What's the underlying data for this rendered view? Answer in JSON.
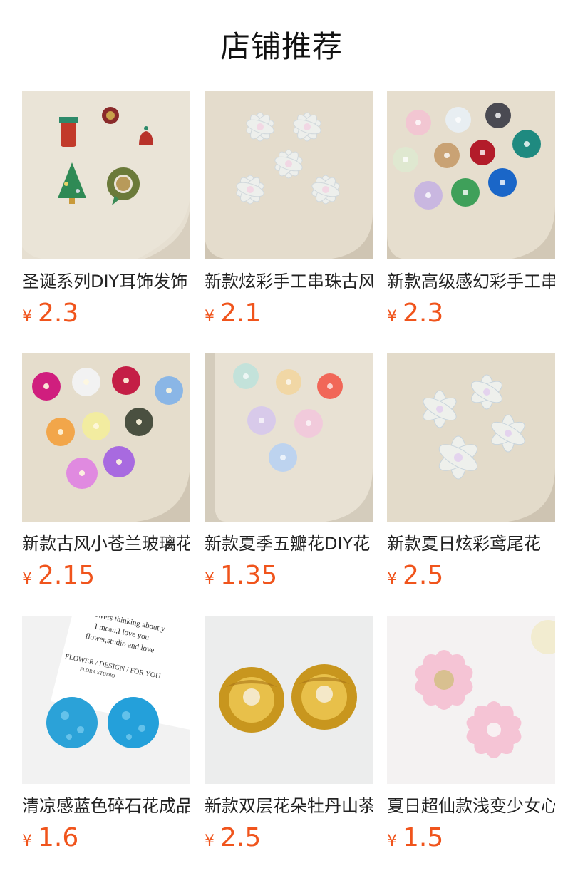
{
  "section": {
    "title": "店铺推荐"
  },
  "colors": {
    "price": "#f0541c",
    "text": "#222222"
  },
  "products": [
    {
      "name": "圣诞系列DIY耳饰发饰",
      "currency": "¥",
      "price": "2.3",
      "image_icon": "christmas-ornaments-image"
    },
    {
      "name": "新款炫彩手工串珠古风",
      "currency": "¥",
      "price": "2.1",
      "image_icon": "iridescent-flowers-image"
    },
    {
      "name": "新款高级感幻彩手工串",
      "currency": "¥",
      "price": "2.3",
      "image_icon": "colorful-sequin-flowers-image"
    },
    {
      "name": "新款古风小苍兰玻璃花",
      "currency": "¥",
      "price": "2.15",
      "image_icon": "freesia-glass-flowers-image"
    },
    {
      "name": "新款夏季五瓣花DIY花",
      "currency": "¥",
      "price": "1.35",
      "image_icon": "five-petal-flowers-image"
    },
    {
      "name": "新款夏日炫彩鸢尾花",
      "currency": "¥",
      "price": "2.5",
      "image_icon": "iris-flowers-image"
    },
    {
      "name": "清凉感蓝色碎石花成品",
      "currency": "¥",
      "price": "1.6",
      "image_icon": "blue-crystal-flowers-image"
    },
    {
      "name": "新款双层花朵牡丹山茶",
      "currency": "¥",
      "price": "2.5",
      "image_icon": "gold-peony-flowers-image"
    },
    {
      "name": "夏日超仙款浅变少女心",
      "currency": "¥",
      "price": "1.5",
      "image_icon": "pink-gradient-flowers-image"
    }
  ],
  "photo_text": {
    "card_line1": "owers thinking about y",
    "card_line2": "I mean,I love you",
    "card_line3": "flower,studio and love",
    "card_line4": "FLOWER / DESIGN / FOR YOU",
    "card_line5": "FLORA STUDIO"
  }
}
